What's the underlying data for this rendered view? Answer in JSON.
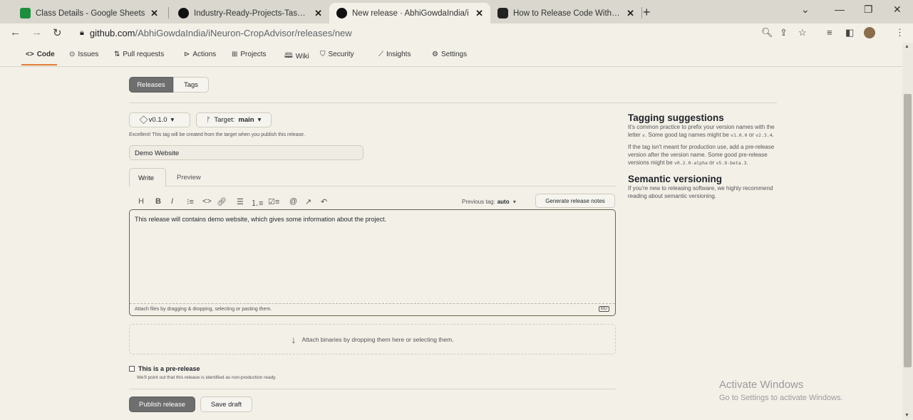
{
  "tabs": [
    {
      "title": "Class Details - Google Sheets",
      "icon": "sheets-icon"
    },
    {
      "title": "Industry-Ready-Projects-Tasks/A",
      "icon": "github-icon"
    },
    {
      "title": "New release · AbhiGowdaIndia/i",
      "icon": "github-icon"
    },
    {
      "title": "How to Release Code With Githu",
      "icon": "youtube-icon"
    }
  ],
  "address": {
    "host": "github.com",
    "path": "/AbhiGowdaIndia/iNeuron-CropAdvisor/releases/new"
  },
  "repo_nav": [
    "Code",
    "Issues",
    "Pull requests",
    "Actions",
    "Projects",
    "Wiki",
    "Security",
    "Insights",
    "Settings"
  ],
  "subnav": {
    "releases": "Releases",
    "tags": "Tags"
  },
  "release": {
    "tag": "v0.1.0",
    "target_label": "Target:",
    "target": "main",
    "tag_note": "Excellent! This tag will be created from the target when you publish this release.",
    "title_value": "Demo Website",
    "write_tab": "Write",
    "preview_tab": "Preview",
    "prev_tag_label": "Previous tag:",
    "prev_tag_value": "auto",
    "generate_notes": "Generate release notes",
    "body": "This release will contains demo website, which gives some information about the project.",
    "attach_files": "Attach files by dragging & dropping, selecting or pasting them.",
    "markdown_badge": "MD",
    "attach_binaries": "Attach binaries by dropping them here or selecting them.",
    "prerelease_label": "This is a pre-release",
    "prerelease_note": "We'll point out that this release is identified as non-production ready.",
    "publish": "Publish release",
    "save_draft": "Save draft"
  },
  "sidebar": {
    "tagging_title": "Tagging suggestions",
    "tagging_p1a": "It's common practice to prefix your version names with the letter",
    "tagging_p1_letter": "v",
    "tagging_p1b": ". Some good tag names might be",
    "tag_ex1": "v1.0.0",
    "or": "or",
    "tag_ex2": "v2.3.4",
    "tagging_p2": "If the tag isn't meant for production use, add a pre-release version after the version name. Some good pre-release versions might be",
    "pre_ex1": "v0.2.0-alpha",
    "pre_ex2": "v5.9-beta.3",
    "semver_title": "Semantic versioning",
    "semver_p": "If you're new to releasing software, we highly recommend reading about semantic versioning."
  },
  "watermark": {
    "line1": "Activate Windows",
    "line2": "Go to Settings to activate Windows."
  }
}
